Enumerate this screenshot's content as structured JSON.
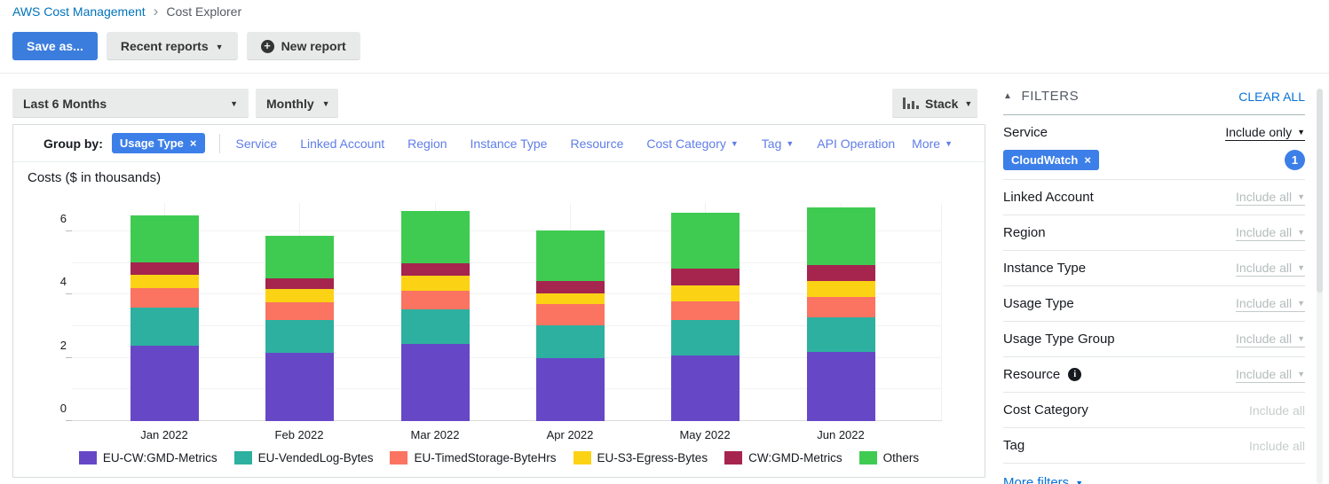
{
  "breadcrumb": {
    "root": "AWS Cost Management",
    "current": "Cost Explorer"
  },
  "toolbar": {
    "save_as": "Save as...",
    "recent_reports": "Recent reports",
    "new_report": "New report"
  },
  "controls": {
    "date_range": "Last 6 Months",
    "granularity": "Monthly",
    "chart_style": "Stack"
  },
  "group_by": {
    "label": "Group by:",
    "selected_tag": "Usage Type",
    "links": [
      {
        "label": "Service",
        "caret": false
      },
      {
        "label": "Linked Account",
        "caret": false
      },
      {
        "label": "Region",
        "caret": false
      },
      {
        "label": "Instance Type",
        "caret": false
      },
      {
        "label": "Resource",
        "caret": false
      },
      {
        "label": "Cost Category",
        "caret": true
      },
      {
        "label": "Tag",
        "caret": true
      },
      {
        "label": "API Operation",
        "caret": false
      }
    ],
    "more_label": "More"
  },
  "chart_data": {
    "type": "bar",
    "stacked": true,
    "title": "Costs ($ in thousands)",
    "categories": [
      "Jan 2022",
      "Feb 2022",
      "Mar 2022",
      "Apr 2022",
      "May 2022",
      "Jun 2022"
    ],
    "series": [
      {
        "name": "EU-CW:GMD-Metrics",
        "color": "#6648c7",
        "values": [
          2.38,
          2.17,
          2.43,
          1.98,
          2.07,
          2.18
        ]
      },
      {
        "name": "EU-VendedLog-Bytes",
        "color": "#2eb0a0",
        "values": [
          1.21,
          1.02,
          1.11,
          1.05,
          1.14,
          1.11
        ]
      },
      {
        "name": "EU-TimedStorage-ByteHrs",
        "color": "#fa7461",
        "values": [
          0.61,
          0.56,
          0.59,
          0.68,
          0.59,
          0.65
        ]
      },
      {
        "name": "EU-S3-Egress-Bytes",
        "color": "#fcd215",
        "values": [
          0.42,
          0.42,
          0.46,
          0.32,
          0.49,
          0.49
        ]
      },
      {
        "name": "CW:GMD-Metrics",
        "color": "#a5254f",
        "values": [
          0.4,
          0.36,
          0.4,
          0.4,
          0.54,
          0.51
        ]
      },
      {
        "name": "Others",
        "color": "#3fcb52",
        "values": [
          1.48,
          1.32,
          1.66,
          1.61,
          1.75,
          1.83
        ]
      }
    ],
    "totals": [
      6.5,
      5.85,
      6.65,
      6.04,
      6.58,
      6.77
    ],
    "yticks": [
      0,
      2,
      4,
      6
    ],
    "ylim": [
      0,
      6.9
    ],
    "xlabel": "",
    "ylabel": "Costs ($ in thousands)",
    "grid": true,
    "legend_position": "bottom"
  },
  "filters": {
    "title": "FILTERS",
    "clear_all": "CLEAR ALL",
    "more_filters": "More filters",
    "rows": [
      {
        "label": "Service",
        "mode": "Include only",
        "style": "active",
        "caret": true,
        "info": false,
        "tag": "CloudWatch",
        "count": "1"
      },
      {
        "label": "Linked Account",
        "mode": "Include all",
        "style": "all",
        "caret": true,
        "info": false
      },
      {
        "label": "Region",
        "mode": "Include all",
        "style": "all",
        "caret": true,
        "info": false
      },
      {
        "label": "Instance Type",
        "mode": "Include all",
        "style": "all",
        "caret": true,
        "info": false
      },
      {
        "label": "Usage Type",
        "mode": "Include all",
        "style": "all",
        "caret": true,
        "info": false
      },
      {
        "label": "Usage Type Group",
        "mode": "Include all",
        "style": "all",
        "caret": true,
        "info": false
      },
      {
        "label": "Resource",
        "mode": "Include all",
        "style": "all",
        "caret": true,
        "info": true
      },
      {
        "label": "Cost Category",
        "mode": "Include all",
        "style": "plain",
        "caret": false,
        "info": false
      },
      {
        "label": "Tag",
        "mode": "Include all",
        "style": "plain",
        "caret": false,
        "info": false
      }
    ]
  },
  "colors": {
    "action_blue": "#3d7fe8",
    "link_blue": "#0073bb",
    "clear_all_blue": "#0972d3",
    "groupby_link_blue": "#5f7de8",
    "primary_button_blue": "#3b7ddd"
  }
}
